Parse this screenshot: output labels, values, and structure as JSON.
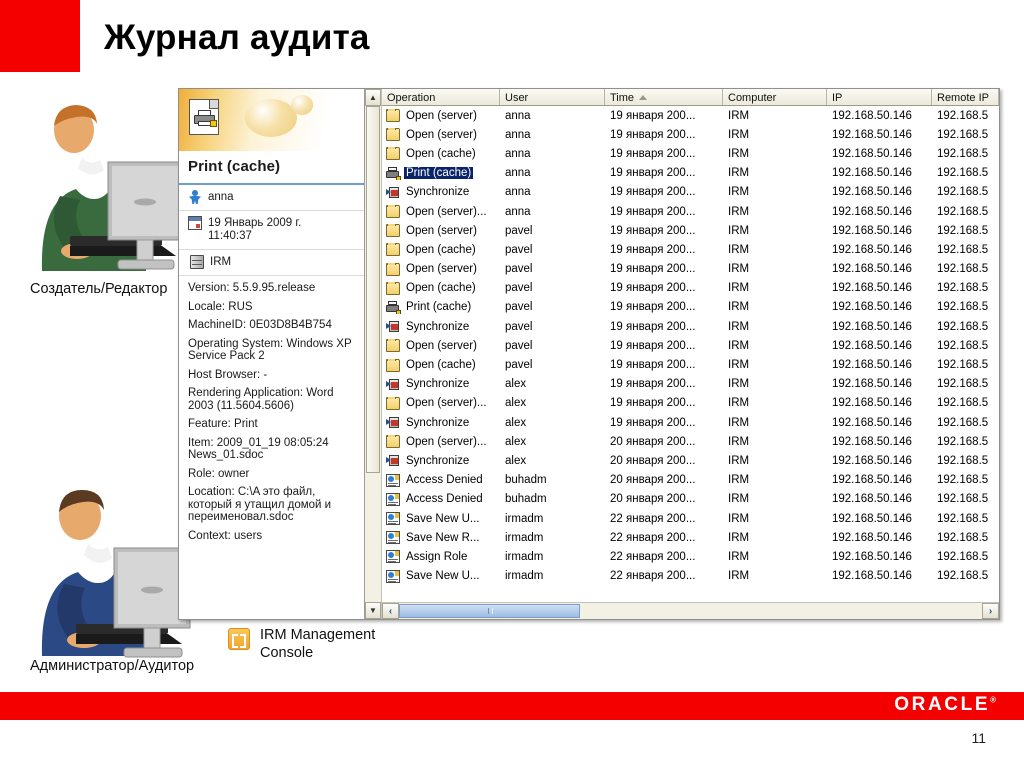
{
  "slide": {
    "title": "Журнал аудита",
    "page_number": "11",
    "brand": "ORACLE",
    "brand_color": "#f50000"
  },
  "captions": {
    "creator": "Создатель/Редактор",
    "admin": "Администратор/Аудитор",
    "console_label": "IRM Management\nConsole"
  },
  "details": {
    "title": "Print (cache)",
    "user": "anna",
    "datetime": "19 Январь 2009 г.\n11:40:37",
    "computer": "IRM",
    "properties": [
      "Version: 5.5.9.95.release",
      "Locale: RUS",
      "MachineID: 0E03D8B4B754",
      "Operating System: Windows XP Service Pack 2",
      "Host Browser: -",
      "Rendering Application: Word 2003 (11.5604.5606)",
      "Feature: Print",
      "Item: 2009_01_19 08:05:24 News_01.sdoc",
      "Role: owner",
      "Location: C:\\A это файл, который я утащил домой и переименовал.sdoc",
      "Context: users"
    ]
  },
  "table": {
    "columns": [
      "Operation",
      "User",
      "Time",
      "Computer",
      "IP",
      "Remote IP"
    ],
    "sorted_column": "Time",
    "sort_direction": "asc",
    "rows": [
      {
        "icon": "folder",
        "operation": "Open (server)",
        "user": "anna",
        "time": "19 января 200...",
        "computer": "IRM",
        "ip": "192.168.50.146",
        "remote_ip": "192.168.5",
        "selected": false
      },
      {
        "icon": "folder",
        "operation": "Open (server)",
        "user": "anna",
        "time": "19 января 200...",
        "computer": "IRM",
        "ip": "192.168.50.146",
        "remote_ip": "192.168.5",
        "selected": false
      },
      {
        "icon": "folder",
        "operation": "Open (cache)",
        "user": "anna",
        "time": "19 января 200...",
        "computer": "IRM",
        "ip": "192.168.50.146",
        "remote_ip": "192.168.5",
        "selected": false
      },
      {
        "icon": "print",
        "operation": "Print (cache)",
        "user": "anna",
        "time": "19 января 200...",
        "computer": "IRM",
        "ip": "192.168.50.146",
        "remote_ip": "192.168.5",
        "selected": true
      },
      {
        "icon": "sync",
        "operation": "Synchronize",
        "user": "anna",
        "time": "19 января 200...",
        "computer": "IRM",
        "ip": "192.168.50.146",
        "remote_ip": "192.168.5",
        "selected": false
      },
      {
        "icon": "folder",
        "operation": "Open (server)...",
        "user": "anna",
        "time": "19 января 200...",
        "computer": "IRM",
        "ip": "192.168.50.146",
        "remote_ip": "192.168.5",
        "selected": false
      },
      {
        "icon": "folder",
        "operation": "Open (server)",
        "user": "pavel",
        "time": "19 января 200...",
        "computer": "IRM",
        "ip": "192.168.50.146",
        "remote_ip": "192.168.5",
        "selected": false
      },
      {
        "icon": "folder",
        "operation": "Open (cache)",
        "user": "pavel",
        "time": "19 января 200...",
        "computer": "IRM",
        "ip": "192.168.50.146",
        "remote_ip": "192.168.5",
        "selected": false
      },
      {
        "icon": "folder",
        "operation": "Open (server)",
        "user": "pavel",
        "time": "19 января 200...",
        "computer": "IRM",
        "ip": "192.168.50.146",
        "remote_ip": "192.168.5",
        "selected": false
      },
      {
        "icon": "folder",
        "operation": "Open (cache)",
        "user": "pavel",
        "time": "19 января 200...",
        "computer": "IRM",
        "ip": "192.168.50.146",
        "remote_ip": "192.168.5",
        "selected": false
      },
      {
        "icon": "print",
        "operation": "Print (cache)",
        "user": "pavel",
        "time": "19 января 200...",
        "computer": "IRM",
        "ip": "192.168.50.146",
        "remote_ip": "192.168.5",
        "selected": false
      },
      {
        "icon": "sync",
        "operation": "Synchronize",
        "user": "pavel",
        "time": "19 января 200...",
        "computer": "IRM",
        "ip": "192.168.50.146",
        "remote_ip": "192.168.5",
        "selected": false
      },
      {
        "icon": "folder",
        "operation": "Open (server)",
        "user": "pavel",
        "time": "19 января 200...",
        "computer": "IRM",
        "ip": "192.168.50.146",
        "remote_ip": "192.168.5",
        "selected": false
      },
      {
        "icon": "folder",
        "operation": "Open (cache)",
        "user": "pavel",
        "time": "19 января 200...",
        "computer": "IRM",
        "ip": "192.168.50.146",
        "remote_ip": "192.168.5",
        "selected": false
      },
      {
        "icon": "sync",
        "operation": "Synchronize",
        "user": "alex",
        "time": "19 января 200...",
        "computer": "IRM",
        "ip": "192.168.50.146",
        "remote_ip": "192.168.5",
        "selected": false
      },
      {
        "icon": "folder",
        "operation": "Open (server)...",
        "user": "alex",
        "time": "19 января 200...",
        "computer": "IRM",
        "ip": "192.168.50.146",
        "remote_ip": "192.168.5",
        "selected": false
      },
      {
        "icon": "sync",
        "operation": "Synchronize",
        "user": "alex",
        "time": "19 января 200...",
        "computer": "IRM",
        "ip": "192.168.50.146",
        "remote_ip": "192.168.5",
        "selected": false
      },
      {
        "icon": "folder",
        "operation": "Open (server)...",
        "user": "alex",
        "time": "20 января 200...",
        "computer": "IRM",
        "ip": "192.168.50.146",
        "remote_ip": "192.168.5",
        "selected": false
      },
      {
        "icon": "sync",
        "operation": "Synchronize",
        "user": "alex",
        "time": "20 января 200...",
        "computer": "IRM",
        "ip": "192.168.50.146",
        "remote_ip": "192.168.5",
        "selected": false
      },
      {
        "icon": "account",
        "operation": "Access Denied",
        "user": "buhadm",
        "time": "20 января 200...",
        "computer": "IRM",
        "ip": "192.168.50.146",
        "remote_ip": "192.168.5",
        "selected": false
      },
      {
        "icon": "account",
        "operation": "Access Denied",
        "user": "buhadm",
        "time": "20 января 200...",
        "computer": "IRM",
        "ip": "192.168.50.146",
        "remote_ip": "192.168.5",
        "selected": false
      },
      {
        "icon": "account",
        "operation": "Save New U...",
        "user": "irmadm",
        "time": "22 января 200...",
        "computer": "IRM",
        "ip": "192.168.50.146",
        "remote_ip": "192.168.5",
        "selected": false
      },
      {
        "icon": "account",
        "operation": "Save New R...",
        "user": "irmadm",
        "time": "22 января 200...",
        "computer": "IRM",
        "ip": "192.168.50.146",
        "remote_ip": "192.168.5",
        "selected": false
      },
      {
        "icon": "account",
        "operation": "Assign Role",
        "user": "irmadm",
        "time": "22 января 200...",
        "computer": "IRM",
        "ip": "192.168.50.146",
        "remote_ip": "192.168.5",
        "selected": false
      },
      {
        "icon": "account",
        "operation": "Save New U...",
        "user": "irmadm",
        "time": "22 января 200...",
        "computer": "IRM",
        "ip": "192.168.50.146",
        "remote_ip": "192.168.5",
        "selected": false
      }
    ]
  },
  "scrollbars": {
    "up_arrow": "▲",
    "down_arrow": "▼",
    "left_arrow": "‹",
    "right_arrow": "›"
  }
}
